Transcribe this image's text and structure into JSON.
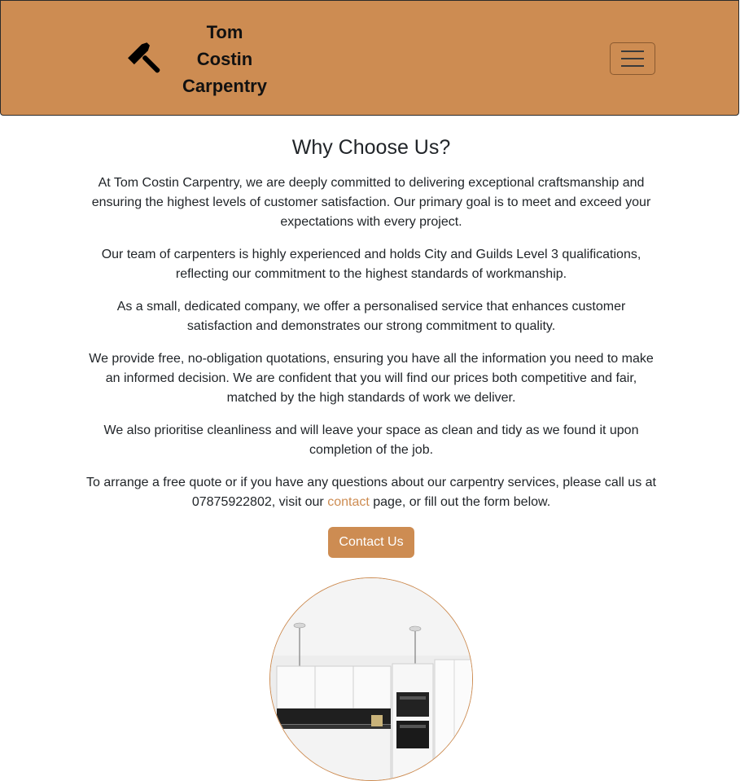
{
  "navbar": {
    "brand_line1": "Tom Costin",
    "brand_line2": "Carpentry",
    "brand_icon": "hammer-icon",
    "toggler_icon": "hamburger-menu-icon",
    "background_color": "#cd8c52"
  },
  "main": {
    "heading": "Why Choose Us?",
    "paragraphs": [
      "At Tom Costin Carpentry, we are deeply committed to delivering exceptional craftsmanship and ensuring the highest levels of customer satisfaction. Our primary goal is to meet and exceed your expectations with every project.",
      "Our team of carpenters is highly experienced and holds City and Guilds Level 3 qualifications, reflecting our commitment to the highest standards of workmanship.",
      "As a small, dedicated company, we offer a personalised service that enhances customer satisfaction and demonstrates our strong commitment to quality.",
      "We provide free, no-obligation quotations, ensuring you have all the information you need to make an informed decision. We are confident that you will find our prices both competitive and fair, matched by the high standards of work we deliver.",
      "We also prioritise cleanliness and will leave your space as clean and tidy as we found it upon completion of the job."
    ],
    "last_paragraph": {
      "before_link": "To arrange a free quote or if you have any questions about our carpentry services, please call us at 07875922802, visit our ",
      "link_text": "contact",
      "after_link": " page, or fill out the form below."
    },
    "contact_button": "Contact Us",
    "accent_color": "#cd8c52"
  }
}
